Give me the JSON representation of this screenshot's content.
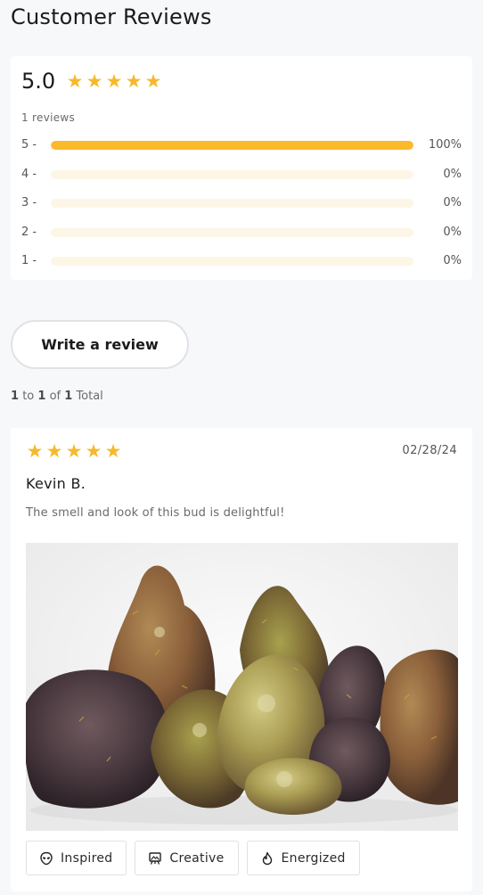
{
  "page": {
    "title": "Customer Reviews"
  },
  "summary": {
    "average": "5.0",
    "rating": 5,
    "review_count_text": "1 reviews",
    "distribution": [
      {
        "label": "5 -",
        "percent_text": "100%",
        "fraction": 1.0
      },
      {
        "label": "4 -",
        "percent_text": "0%",
        "fraction": 0
      },
      {
        "label": "3 -",
        "percent_text": "0%",
        "fraction": 0
      },
      {
        "label": "2 -",
        "percent_text": "0%",
        "fraction": 0
      },
      {
        "label": "1 -",
        "percent_text": "0%",
        "fraction": 0
      }
    ]
  },
  "actions": {
    "write_review_label": "Write a review"
  },
  "pagination": {
    "from": "1",
    "to_word": "to",
    "to": "1",
    "of_word": "of",
    "total": "1",
    "total_word": "Total"
  },
  "review": {
    "rating": 5,
    "date": "02/28/24",
    "author": "Kevin B.",
    "text": "The smell and look of this bud is delightful!",
    "tags": [
      {
        "label": "Inspired",
        "icon": "alien-face-icon"
      },
      {
        "label": "Creative",
        "icon": "painting-icon"
      },
      {
        "label": "Energized",
        "icon": "flame-icon"
      }
    ]
  },
  "colors": {
    "star": "#f6b92b",
    "bar_fill": "#fbba2b",
    "bar_track": "#fdf6e6"
  }
}
